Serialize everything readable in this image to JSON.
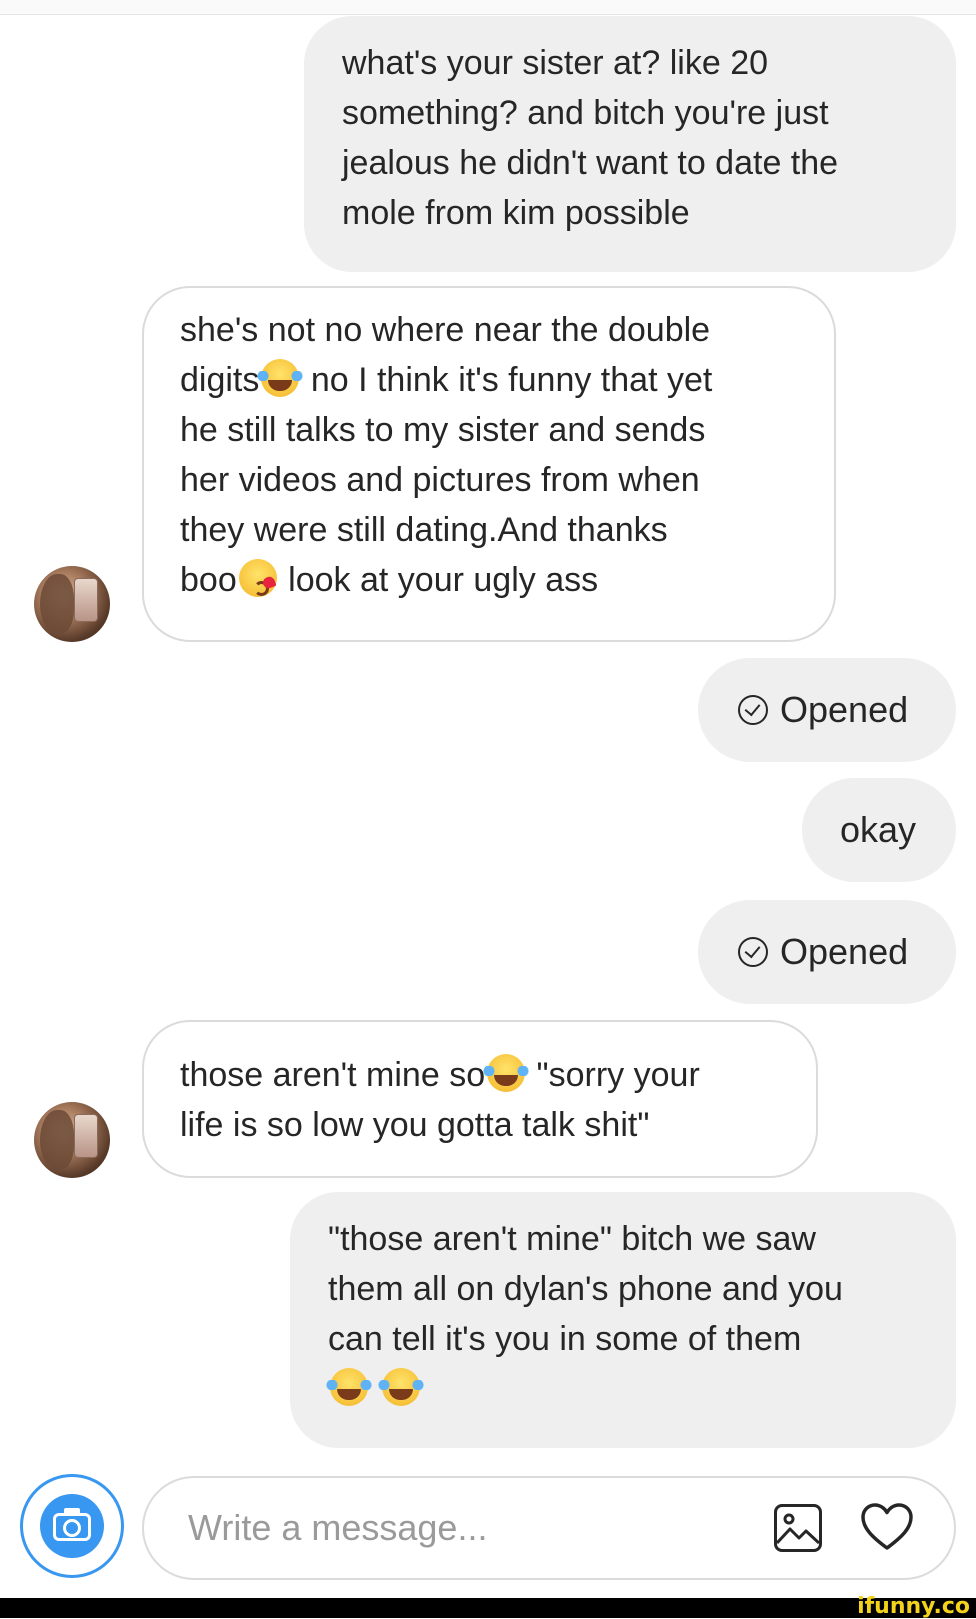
{
  "messages": [
    {
      "lines": [
        "what's your sister at? like 20",
        "something? and bitch you're just",
        "jealous he didn't want to date the",
        "mole from kim possible"
      ]
    },
    {
      "line1": "she's not no where near the double",
      "line2_pre": "digits",
      "line2_post": " no I think it's funny that yet",
      "line3": "he still talks to my sister and sends",
      "line4": "her videos and pictures from when",
      "line5": "they were still dating.And thanks",
      "line6_pre": "boo",
      "line6_post": " look at your ugly ass"
    },
    {
      "status": "Opened"
    },
    {
      "text": "okay"
    },
    {
      "status": "Opened"
    },
    {
      "line1_pre": "those aren't mine so",
      "line1_post": " \"sorry your",
      "line2": "life is so low you gotta talk shit\""
    },
    {
      "lines": [
        "\"those aren't mine\" bitch we saw",
        "them all on dylan's phone and you",
        "can tell it's you in some of them"
      ]
    }
  ],
  "composer": {
    "placeholder": "Write a message..."
  },
  "icons": {
    "camera": "camera-icon",
    "gallery": "gallery-icon",
    "heart": "heart-icon",
    "status": "check-circle-icon",
    "emoji_laugh": "tears-of-joy-emoji",
    "emoji_kiss": "blowing-kiss-emoji"
  },
  "colors": {
    "accent": "#3897f0",
    "sent_bubble": "#efefef",
    "received_border": "#dbdbdb"
  },
  "watermark": "ifunny.co"
}
